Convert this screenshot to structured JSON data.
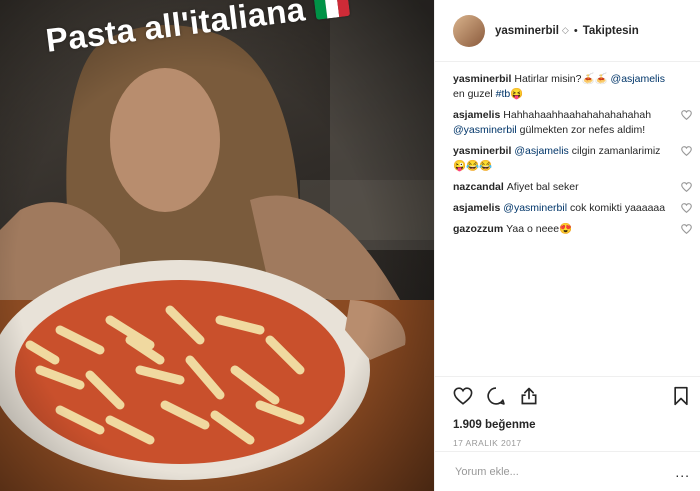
{
  "photo": {
    "caption": "Pasta all'italiana",
    "flag_colors": [
      "#009246",
      "#ffffff",
      "#ce2b37"
    ]
  },
  "header": {
    "username": "yasminerbil",
    "verified_glyph": "◇",
    "separator": "•",
    "follow_label": "Takiptesin"
  },
  "comments": [
    {
      "user": "yasminerbil",
      "parts": [
        {
          "t": "text",
          "v": "Hatirlar misin?🍝🍝 "
        },
        {
          "t": "mention",
          "v": "@asjamelis"
        },
        {
          "t": "text",
          "v": " en guzel "
        },
        {
          "t": "hashtag",
          "v": "#tb"
        },
        {
          "t": "text",
          "v": "😝"
        }
      ],
      "likeable": false
    },
    {
      "user": "asjamelis",
      "parts": [
        {
          "t": "text",
          "v": "Hahhahaahhaahahahahahahah "
        },
        {
          "t": "mention",
          "v": "@yasminerbil"
        },
        {
          "t": "text",
          "v": " gülmekten zor nefes aldim!"
        }
      ],
      "likeable": true
    },
    {
      "user": "yasminerbil",
      "parts": [
        {
          "t": "mention",
          "v": "@asjamelis"
        },
        {
          "t": "text",
          "v": " cilgin zamanlarimiz😜😂😂"
        }
      ],
      "likeable": true
    },
    {
      "user": "nazcandal",
      "parts": [
        {
          "t": "text",
          "v": "Afiyet bal seker"
        }
      ],
      "likeable": true
    },
    {
      "user": "asjamelis",
      "parts": [
        {
          "t": "mention",
          "v": "@yasminerbil"
        },
        {
          "t": "text",
          "v": " cok komikti yaaaaaa"
        }
      ],
      "likeable": true
    },
    {
      "user": "gazozzum",
      "parts": [
        {
          "t": "text",
          "v": "Yaa o neee😍"
        }
      ],
      "likeable": true
    }
  ],
  "actions": {
    "like_icon": "heart-icon",
    "comment_icon": "comment-icon",
    "share_icon": "share-icon",
    "save_icon": "bookmark-icon"
  },
  "likes": "1.909 beğenme",
  "date": "17 ARALIK 2017",
  "add_comment": {
    "placeholder": "Yorum ekle...",
    "more_label": "..."
  }
}
